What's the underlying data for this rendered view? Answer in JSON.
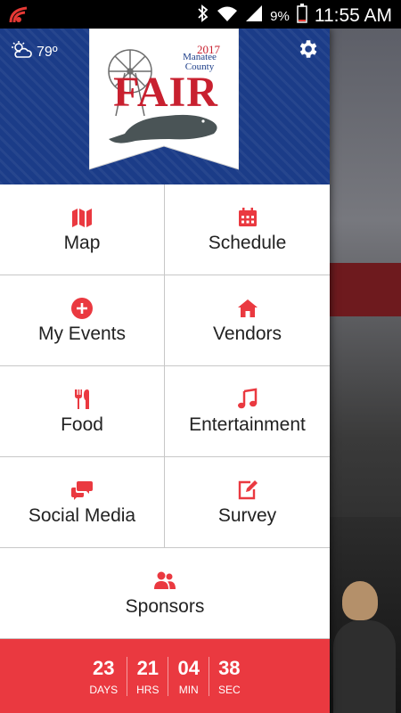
{
  "status_bar": {
    "battery_percent": "9%",
    "time": "11:55 AM"
  },
  "header": {
    "temperature": "79º",
    "logo": {
      "year": "2017",
      "line1": "Manatee",
      "line2": "County",
      "word": "FAIR"
    }
  },
  "menu": [
    {
      "label": "Map",
      "icon": "map-icon"
    },
    {
      "label": "Schedule",
      "icon": "calendar-icon"
    },
    {
      "label": "My Events",
      "icon": "plus-circle-icon"
    },
    {
      "label": "Vendors",
      "icon": "store-icon"
    },
    {
      "label": "Food",
      "icon": "utensils-icon"
    },
    {
      "label": "Entertainment",
      "icon": "music-icon"
    },
    {
      "label": "Social Media",
      "icon": "chat-bubbles-icon"
    },
    {
      "label": "Survey",
      "icon": "edit-icon"
    },
    {
      "label": "Sponsors",
      "icon": "people-icon"
    }
  ],
  "countdown": {
    "days": {
      "value": "23",
      "label": "DAYS"
    },
    "hours": {
      "value": "21",
      "label": "HRS"
    },
    "minutes": {
      "value": "04",
      "label": "MIN"
    },
    "seconds": {
      "value": "38",
      "label": "SEC"
    }
  },
  "colors": {
    "accent_red": "#ea3940",
    "header_blue": "#1b3c88"
  }
}
